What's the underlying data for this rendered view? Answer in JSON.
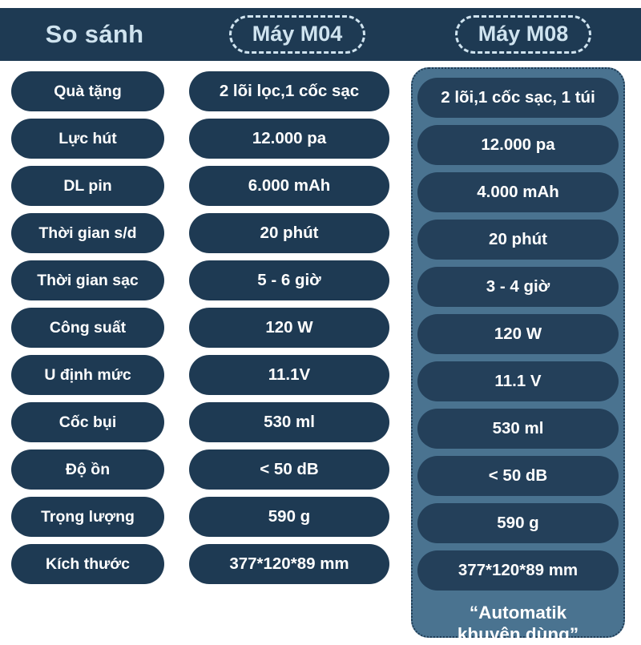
{
  "header": {
    "title": "So sánh",
    "columns": [
      {
        "label": "Máy M04"
      },
      {
        "label": "Máy M08"
      }
    ]
  },
  "theme": {
    "page_background": "#ffffff",
    "header_background": "#1e3a53",
    "header_text": "#cfe3ef",
    "pill_background": "#1e3a53",
    "pill_text": "#ffffff",
    "highlight_panel": "#4a7390",
    "highlight_pill_background": "#24405a"
  },
  "comparison": {
    "row_labels": [
      "Quà tặng",
      "Lực hút",
      "DL pin",
      "Thời gian s/d",
      "Thời gian sạc",
      "Công suất",
      "U định mức",
      "Cốc bụi",
      "Độ ồn",
      "Trọng lượng",
      "Kích thước"
    ],
    "m04_values": [
      "2 lõi lọc,1 cốc sạc",
      "12.000 pa",
      "6.000 mAh",
      "20 phút",
      "5 - 6 giờ",
      "120 W",
      "11.1V",
      "530 ml",
      "< 50 dB",
      "590 g",
      "377*120*89 mm"
    ],
    "m08_values": [
      "2 lõi,1 cốc sạc, 1 túi",
      "12.000 pa",
      "4.000 mAh",
      "20 phút",
      "3 - 4 giờ",
      "120 W",
      "11.1 V",
      "530 ml",
      "< 50 dB",
      "590 g",
      "377*120*89 mm"
    ],
    "m08_footnote": "“Automatik\nkhuyên dùng”"
  }
}
